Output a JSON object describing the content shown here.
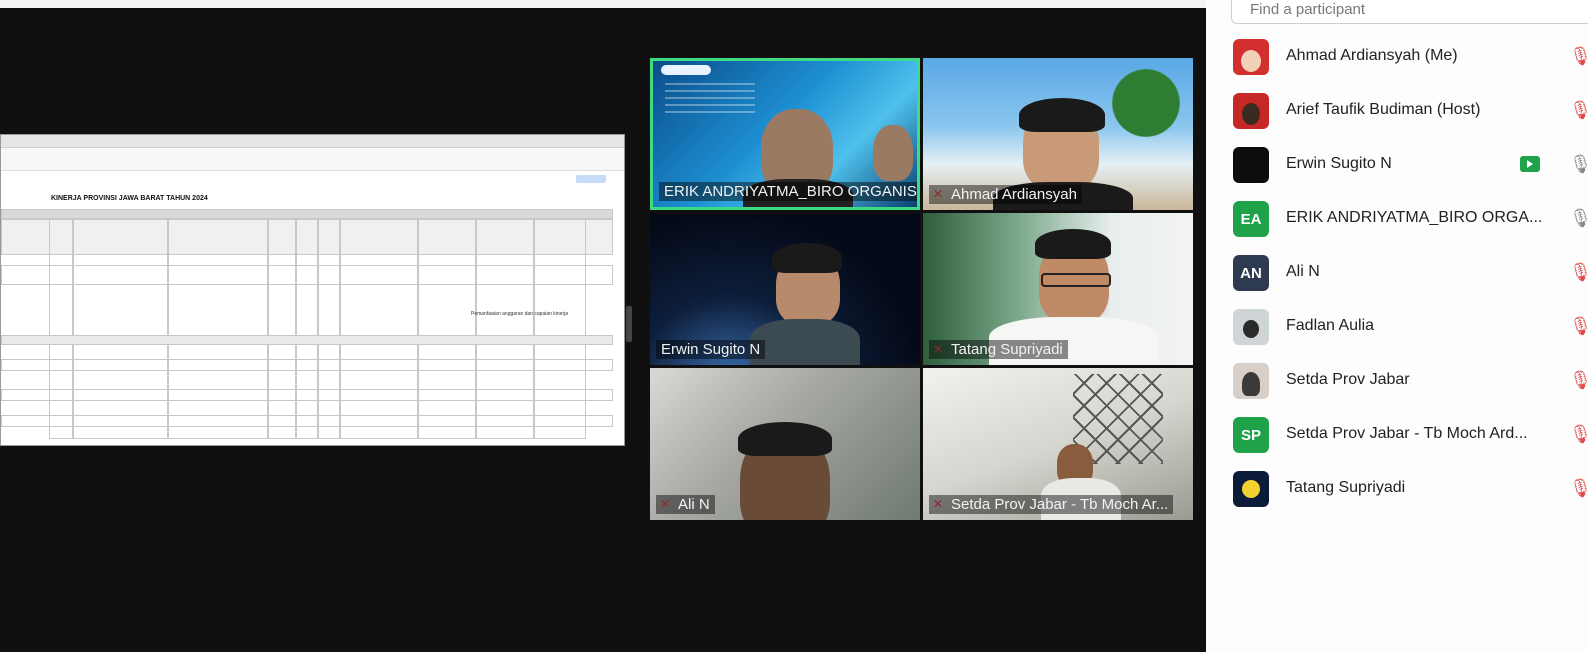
{
  "share": {
    "title": "KINERJA PROVINSI JAWA BARAT TAHUN 2024",
    "note": "Pemanfaatan anggaran dan capaian kinerja"
  },
  "tiles": [
    {
      "name": "ERIK ANDRIYATMA_BIRO ORGANIS",
      "muted": false,
      "speaking": true
    },
    {
      "name": "Ahmad Ardiansyah",
      "muted": true
    },
    {
      "name": "Erwin Sugito N",
      "muted": false
    },
    {
      "name": "Tatang Supriyadi",
      "muted": true
    },
    {
      "name": "Ali N",
      "muted": true
    },
    {
      "name": "Setda Prov Jabar - Tb Moch Ar...",
      "muted": true
    }
  ],
  "panel": {
    "search_placeholder": "Find a participant",
    "participants": [
      {
        "name": "Ahmad Ardiansyah (Me)",
        "avatar": "photo",
        "status": "muted"
      },
      {
        "name": "Arief Taufik Budiman (Host)",
        "avatar": "photo",
        "status": "muted"
      },
      {
        "name": "Erwin Sugito N",
        "avatar": "photo-dark",
        "status": "unmuted",
        "video": true
      },
      {
        "name": "ERIK ANDRIYATMA_BIRO ORGA...",
        "avatar": "EA",
        "status": "unmuted"
      },
      {
        "name": "Ali N",
        "avatar": "AN",
        "status": "muted"
      },
      {
        "name": "Fadlan Aulia",
        "avatar": "photo",
        "status": "muted"
      },
      {
        "name": "Setda Prov Jabar",
        "avatar": "photo",
        "status": "muted"
      },
      {
        "name": "Setda Prov Jabar - Tb Moch Ard...",
        "avatar": "SP",
        "status": "muted"
      },
      {
        "name": "Tatang Supriyadi",
        "avatar": "photo-yellow",
        "status": "muted"
      }
    ]
  },
  "colors": {
    "speaker_border": "#3ddc84",
    "muted": "#e24a4a",
    "avatar_green": "#1fa34a",
    "avatar_navy": "#2d3a4f"
  }
}
